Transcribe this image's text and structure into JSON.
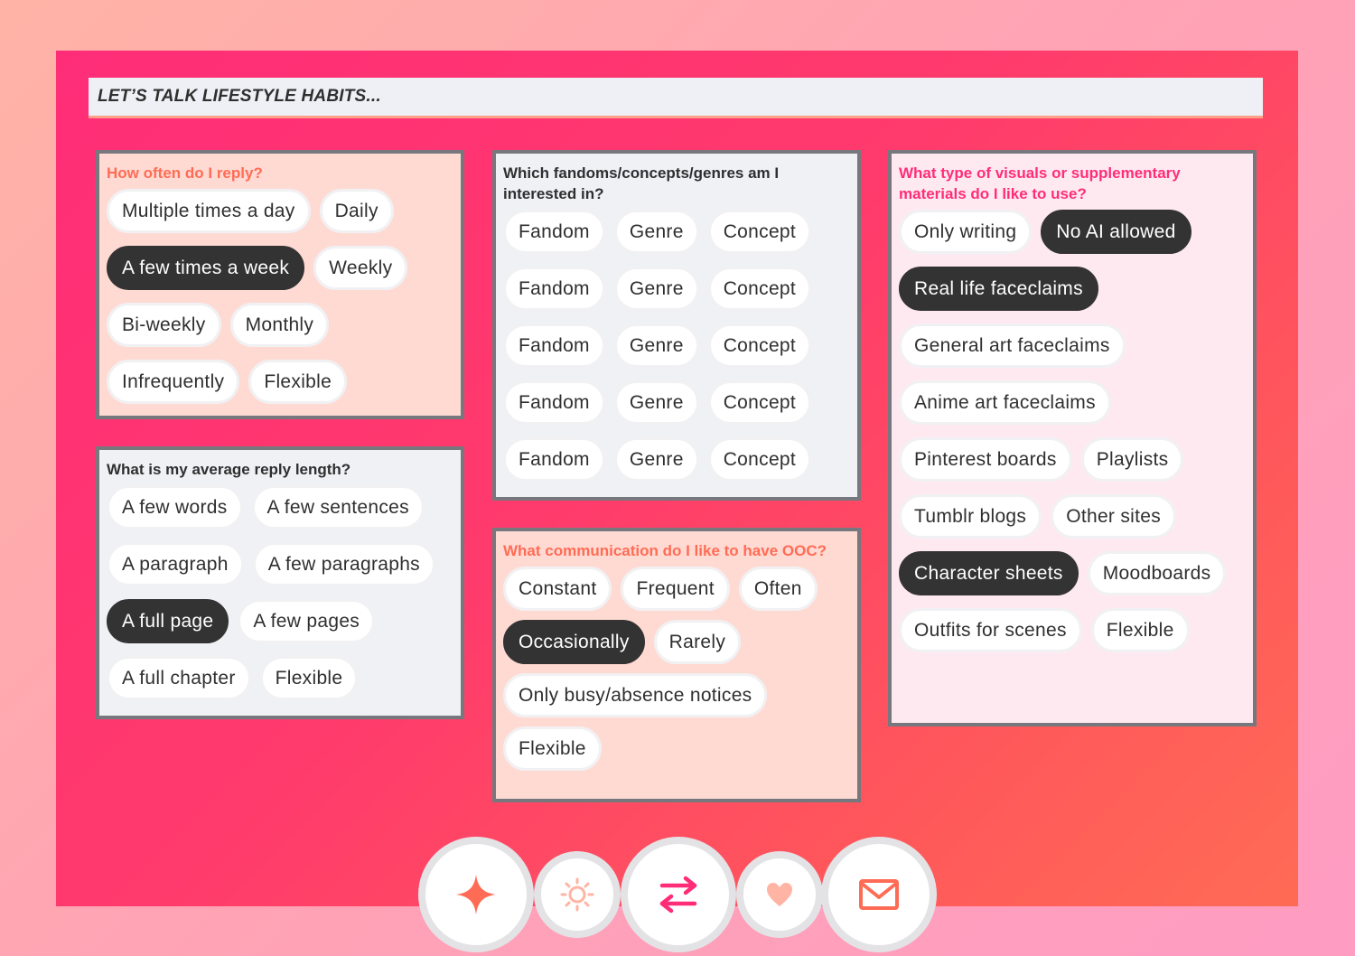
{
  "header": {
    "title": "LET’S TALK LIFESTYLE HABITS..."
  },
  "colors": {
    "accent_coral": "#ff6c55",
    "accent_magenta": "#ff2d78",
    "selected_chip": "#333333",
    "card_border": "#77787d"
  },
  "sections": {
    "reply_frequency": {
      "question": "How often do I reply?",
      "options": [
        {
          "label": "Multiple times a day",
          "selected": false
        },
        {
          "label": "Daily",
          "selected": false
        },
        {
          "label": "A few times a week",
          "selected": true
        },
        {
          "label": "Weekly",
          "selected": false
        },
        {
          "label": "Bi-weekly",
          "selected": false
        },
        {
          "label": "Monthly",
          "selected": false
        },
        {
          "label": "Infrequently",
          "selected": false
        },
        {
          "label": "Flexible",
          "selected": false
        }
      ]
    },
    "reply_length": {
      "question": "What is my average reply length?",
      "options": [
        {
          "label": "A few words",
          "selected": false
        },
        {
          "label": "A few sentences",
          "selected": false
        },
        {
          "label": "A paragraph",
          "selected": false
        },
        {
          "label": "A few paragraphs",
          "selected": false
        },
        {
          "label": "A full page",
          "selected": true
        },
        {
          "label": "A few pages",
          "selected": false
        },
        {
          "label": "A full chapter",
          "selected": false
        },
        {
          "label": "Flexible",
          "selected": false
        }
      ]
    },
    "interests": {
      "question": "Which fandoms/concepts/genres am I interested in?",
      "options": [
        {
          "label": "Fandom",
          "selected": false
        },
        {
          "label": "Genre",
          "selected": false
        },
        {
          "label": "Concept",
          "selected": false
        },
        {
          "label": "Fandom",
          "selected": false
        },
        {
          "label": "Genre",
          "selected": false
        },
        {
          "label": "Concept",
          "selected": false
        },
        {
          "label": "Fandom",
          "selected": false
        },
        {
          "label": "Genre",
          "selected": false
        },
        {
          "label": "Concept",
          "selected": false
        },
        {
          "label": "Fandom",
          "selected": false
        },
        {
          "label": "Genre",
          "selected": false
        },
        {
          "label": "Concept",
          "selected": false
        },
        {
          "label": "Fandom",
          "selected": false
        },
        {
          "label": "Genre",
          "selected": false
        },
        {
          "label": "Concept",
          "selected": false
        }
      ]
    },
    "ooc": {
      "question": "What communication do I like to have OOC?",
      "options": [
        {
          "label": "Constant",
          "selected": false
        },
        {
          "label": "Frequent",
          "selected": false
        },
        {
          "label": "Often",
          "selected": false
        },
        {
          "label": "Occasionally",
          "selected": true
        },
        {
          "label": "Rarely",
          "selected": false
        },
        {
          "label": "Only busy/absence notices",
          "selected": false
        },
        {
          "label": "Flexible",
          "selected": false
        }
      ]
    },
    "visuals": {
      "question": "What type of visuals or supplementary materials do I like to use?",
      "options": [
        {
          "label": "Only writing",
          "selected": false
        },
        {
          "label": "No AI allowed",
          "selected": true
        },
        {
          "label": "Real life faceclaims",
          "selected": true
        },
        {
          "label": "General art faceclaims",
          "selected": false
        },
        {
          "label": "Anime art faceclaims",
          "selected": false
        },
        {
          "label": "Pinterest boards",
          "selected": false
        },
        {
          "label": "Playlists",
          "selected": false
        },
        {
          "label": "Tumblr blogs",
          "selected": false
        },
        {
          "label": "Other sites",
          "selected": false
        },
        {
          "label": "Character sheets",
          "selected": true
        },
        {
          "label": "Moodboards",
          "selected": false
        },
        {
          "label": "Outfits for scenes",
          "selected": false
        },
        {
          "label": "Flexible",
          "selected": false
        }
      ]
    }
  },
  "nav": [
    {
      "icon": "sparkle-icon",
      "color": "#ff6c55"
    },
    {
      "icon": "sun-icon",
      "color": "#ffb4a4"
    },
    {
      "icon": "swap-arrows-icon",
      "color": "#ff2d78"
    },
    {
      "icon": "heart-icon",
      "color": "#ffb4a4"
    },
    {
      "icon": "mail-icon",
      "color": "#ff6c55"
    }
  ]
}
